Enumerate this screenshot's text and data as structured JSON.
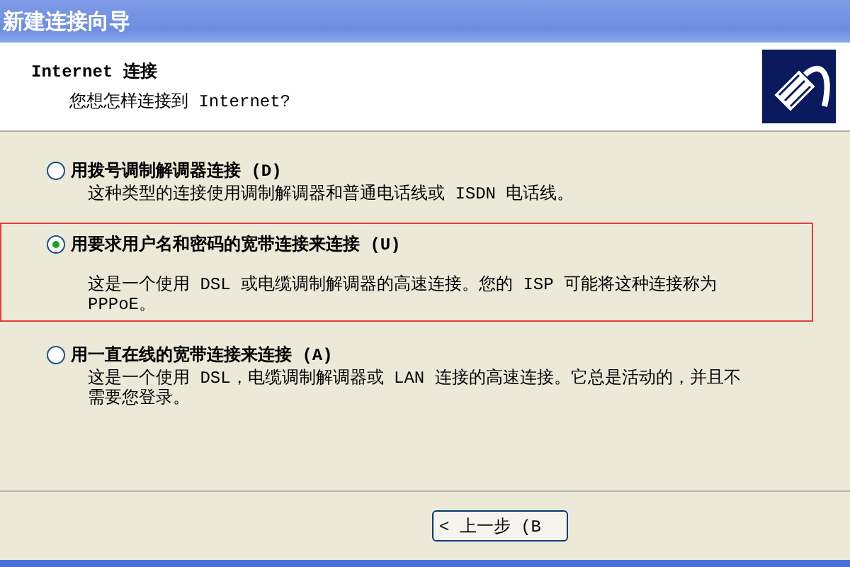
{
  "window": {
    "title": "新建连接向导"
  },
  "header": {
    "title": "Internet 连接",
    "subtitle": "您想怎样连接到 Internet?"
  },
  "options": [
    {
      "label": "用拨号调制解调器连接 (D)",
      "description": "这种类型的连接使用调制解调器和普通电话线或 ISDN 电话线。",
      "selected": false,
      "highlighted": false
    },
    {
      "label": "用要求用户名和密码的宽带连接来连接 (U)",
      "description": "这是一个使用 DSL 或电缆调制解调器的高速连接。您的 ISP 可能将这种连接称为 PPPoE。",
      "selected": true,
      "highlighted": true
    },
    {
      "label": "用一直在线的宽带连接来连接 (A)",
      "description": "这是一个使用 DSL，电缆调制解调器或 LAN 连接的高速连接。它总是活动的，并且不需要您登录。",
      "selected": false,
      "highlighted": false
    }
  ],
  "buttons": [
    {
      "label": "< 上一步 (B"
    }
  ]
}
